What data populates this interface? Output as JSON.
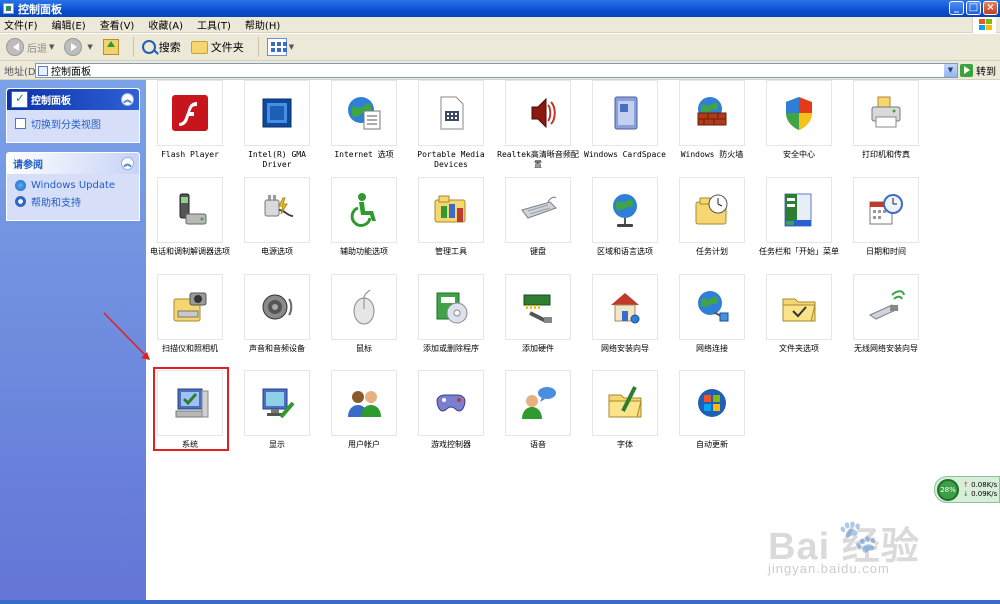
{
  "window": {
    "title": "控制面板",
    "controls": {
      "minimize": "_",
      "maximize": "□",
      "close": "×"
    }
  },
  "menu": [
    "文件(F)",
    "编辑(E)",
    "查看(V)",
    "收藏(A)",
    "工具(T)",
    "帮助(H)"
  ],
  "toolbar": {
    "back_label": "后退",
    "search_label": "搜索",
    "folders_label": "文件夹"
  },
  "address": {
    "label": "地址(D)",
    "value": "控制面板",
    "go_label": "转到"
  },
  "taskpane": {
    "cp_panel_title": "控制面板",
    "switch_view": "切换到分类视图",
    "see_also_title": "请参阅",
    "see_also_links": [
      "Windows Update",
      "帮助和支持"
    ]
  },
  "items": [
    {
      "label": "Flash Player",
      "icon": "flash-player-icon"
    },
    {
      "label": "Intel(R) GMA Driver",
      "icon": "intel-gma-icon"
    },
    {
      "label": "Internet 选项",
      "icon": "internet-options-icon"
    },
    {
      "label": "Portable Media Devices",
      "icon": "portable-media-icon"
    },
    {
      "label": "Realtek高清晰音频配置",
      "icon": "realtek-audio-icon"
    },
    {
      "label": "Windows CardSpace",
      "icon": "cardspace-icon"
    },
    {
      "label": "Windows 防火墙",
      "icon": "firewall-icon"
    },
    {
      "label": "安全中心",
      "icon": "security-center-icon"
    },
    {
      "label": "打印机和传真",
      "icon": "printer-icon"
    },
    {
      "label": "电话和调制解调器选项",
      "icon": "phone-modem-icon"
    },
    {
      "label": "电源选项",
      "icon": "power-icon"
    },
    {
      "label": "辅助功能选项",
      "icon": "accessibility-icon"
    },
    {
      "label": "管理工具",
      "icon": "admin-tools-icon"
    },
    {
      "label": "键盘",
      "icon": "keyboard-icon"
    },
    {
      "label": "区域和语言选项",
      "icon": "region-globe-icon"
    },
    {
      "label": "任务计划",
      "icon": "scheduled-tasks-icon"
    },
    {
      "label": "任务栏和「开始」菜单",
      "icon": "taskbar-icon"
    },
    {
      "label": "日期和时间",
      "icon": "date-time-icon"
    },
    {
      "label": "扫描仪和照相机",
      "icon": "scanner-camera-icon"
    },
    {
      "label": "声音和音频设备",
      "icon": "speaker-icon"
    },
    {
      "label": "鼠标",
      "icon": "mouse-icon"
    },
    {
      "label": "添加或删除程序",
      "icon": "add-remove-programs-icon"
    },
    {
      "label": "添加硬件",
      "icon": "add-hardware-icon"
    },
    {
      "label": "网络安装向导",
      "icon": "network-setup-icon"
    },
    {
      "label": "网络连接",
      "icon": "network-connections-icon"
    },
    {
      "label": "文件夹选项",
      "icon": "folder-options-icon"
    },
    {
      "label": "无线网络安装向导",
      "icon": "wireless-setup-icon"
    },
    {
      "label": "系统",
      "icon": "system-icon"
    },
    {
      "label": "显示",
      "icon": "display-icon"
    },
    {
      "label": "用户帐户",
      "icon": "user-accounts-icon"
    },
    {
      "label": "游戏控制器",
      "icon": "game-controller-icon"
    },
    {
      "label": "语音",
      "icon": "speech-icon"
    },
    {
      "label": "字体",
      "icon": "fonts-icon"
    },
    {
      "label": "自动更新",
      "icon": "automatic-updates-icon"
    }
  ],
  "net_widget": {
    "percent": "28%",
    "up_rate": "0.08K/s",
    "down_rate": "0.09K/s"
  },
  "watermark": {
    "brand": "Bai 经验",
    "url": "jingyan.baidu.com"
  },
  "colors": {
    "titlebar": "#0a4fd0",
    "taskpane": "#6f8fdf",
    "annotation": "#e02020"
  }
}
